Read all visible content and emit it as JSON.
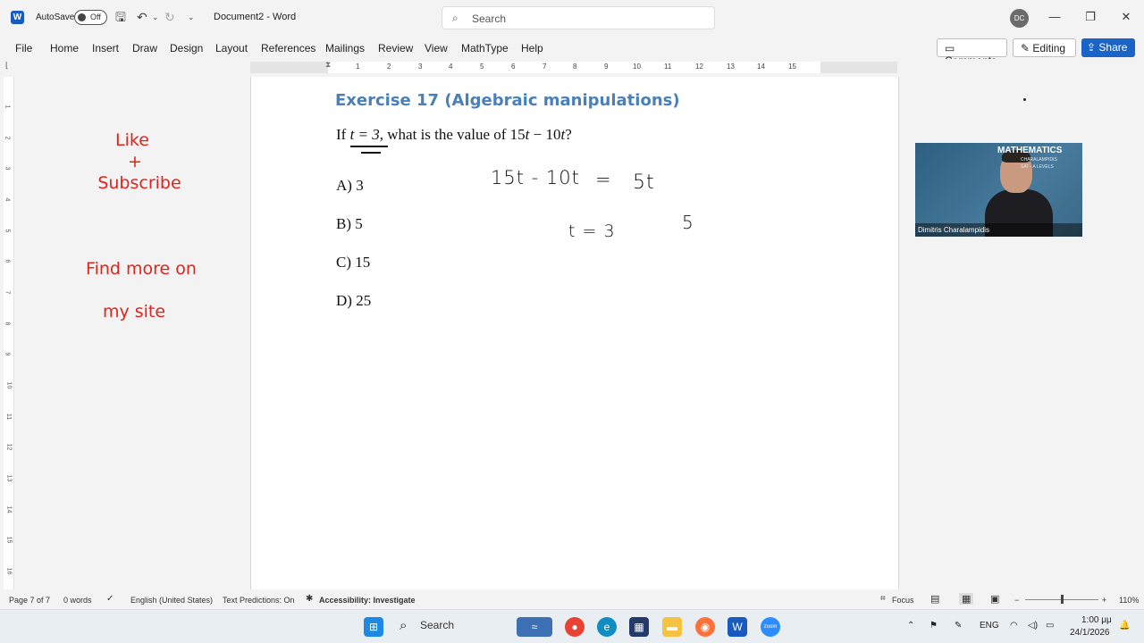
{
  "titlebar": {
    "autosave_label": "AutoSave",
    "toggle_state": "Off",
    "document_title": "Document2 - Word",
    "search_placeholder": "Search",
    "avatar_initials": "DC"
  },
  "menu": {
    "items": [
      "File",
      "Home",
      "Insert",
      "Draw",
      "Design",
      "Layout",
      "References",
      "Mailings",
      "Review",
      "View",
      "MathType",
      "Help"
    ],
    "comments_label": "Comments",
    "editing_label": "Editing",
    "share_label": "Share"
  },
  "ruler": {
    "numbers": [
      "1",
      "2",
      "3",
      "4",
      "5",
      "6",
      "7",
      "8",
      "9",
      "10",
      "11",
      "12",
      "13",
      "14",
      "15"
    ],
    "vertical_numbers": [
      "1",
      "2",
      "3",
      "4",
      "5",
      "6",
      "7",
      "8",
      "9",
      "10",
      "11",
      "12",
      "13",
      "14",
      "15",
      "16"
    ]
  },
  "document": {
    "heading": "Exercise 17 (Algebraic manipulations)",
    "question_prefix": "If ",
    "question_var": "t = 3",
    "question_mid": ", what is the value of 15",
    "question_t1": "t",
    "question_minus": " − 10",
    "question_t2": "t",
    "question_end": "?",
    "options": [
      "A) 3",
      "B) 5",
      "C) 15",
      "D) 25"
    ],
    "handwriting": {
      "line1": "15t - 10t",
      "equals": "=",
      "result": "5t",
      "given": "t = 3",
      "answer": "5"
    }
  },
  "side_notes": {
    "like": "Like",
    "plus": "+",
    "subscribe": "Subscribe",
    "find_more": "Find more on",
    "my_site": "my site"
  },
  "webcam": {
    "title": "MATHEMATICS",
    "subtitle_line1": "CHARALAMPIDIS",
    "subtitle_line2": "SAT - A LEVELS",
    "name": "Dimitris Charalampidis"
  },
  "statusbar": {
    "page": "Page 7 of 7",
    "words": "0 words",
    "language": "English (United States)",
    "predictions": "Text Predictions: On",
    "accessibility": "Accessibility: Investigate",
    "focus": "Focus",
    "zoom": "110%"
  },
  "taskbar": {
    "search_label": "Search",
    "lang": "ENG",
    "time": "1:00 μμ",
    "date": "24/1/2026"
  }
}
